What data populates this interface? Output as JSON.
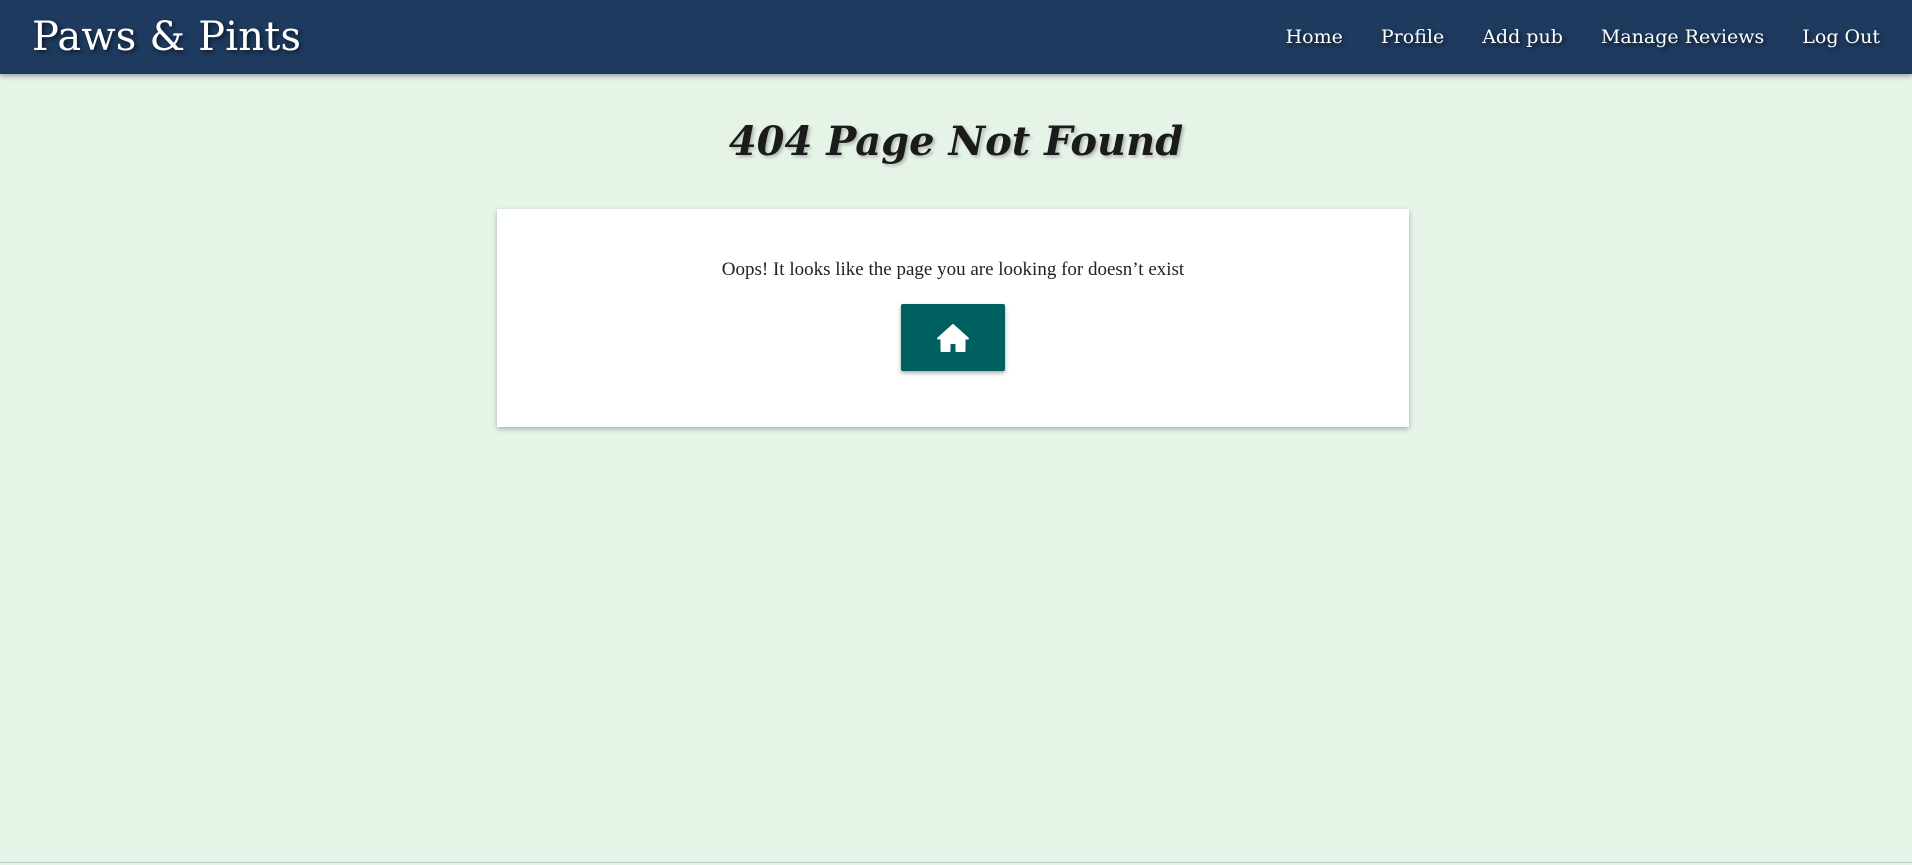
{
  "header": {
    "brand": "Paws & Pints",
    "nav": [
      {
        "label": "Home"
      },
      {
        "label": "Profile"
      },
      {
        "label": "Add pub"
      },
      {
        "label": "Manage Reviews"
      },
      {
        "label": "Log Out"
      }
    ]
  },
  "main": {
    "title": "404 Page Not Found",
    "message": "Oops! It looks like the page you are looking for doesn’t exist",
    "home_button": {
      "icon": "home-icon"
    }
  },
  "colors": {
    "navbar": "#1e3a5f",
    "page_background": "#e6f4e8",
    "button": "#00605f",
    "card": "#ffffff"
  }
}
